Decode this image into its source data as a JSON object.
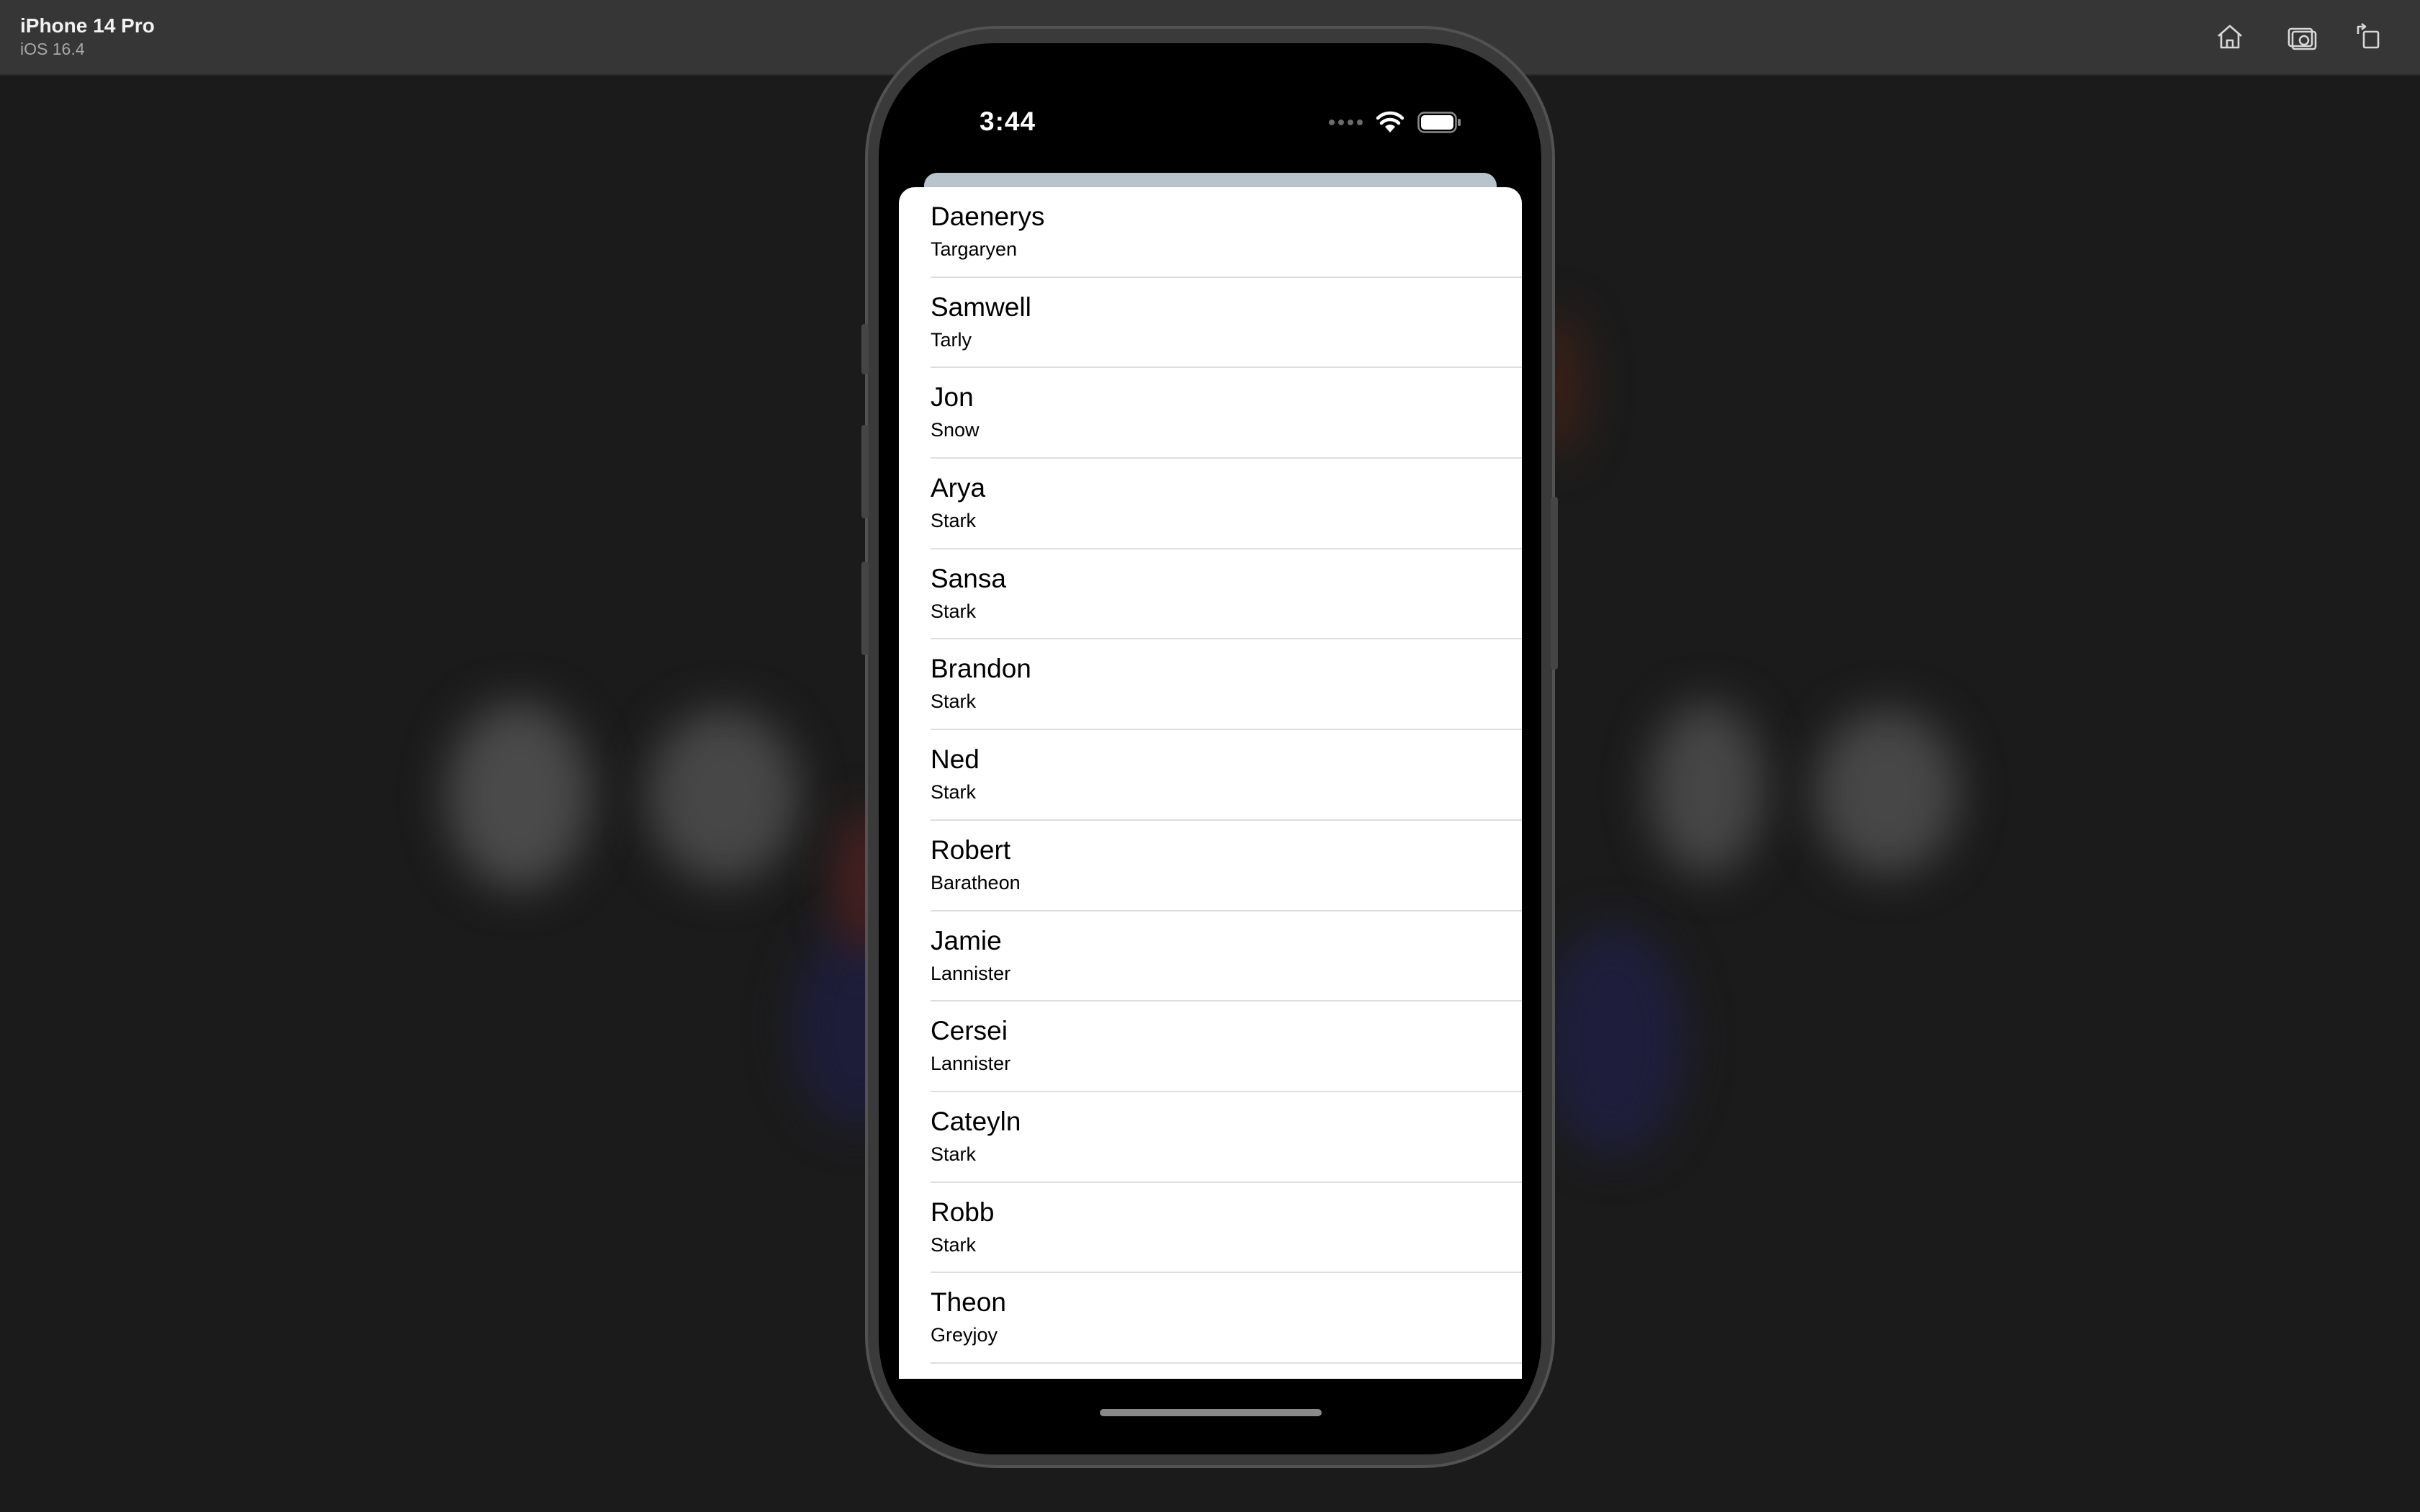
{
  "simulator": {
    "device_name": "iPhone 14 Pro",
    "os_version": "iOS 16.4",
    "buttons": [
      {
        "name": "home",
        "icon": "house-icon"
      },
      {
        "name": "screenshot",
        "icon": "camera-icon"
      },
      {
        "name": "rotate",
        "icon": "rotate-icon"
      }
    ]
  },
  "status_bar": {
    "time": "3:44"
  },
  "list": {
    "items": [
      {
        "first": "Daenerys",
        "last": "Targaryen"
      },
      {
        "first": "Samwell",
        "last": "Tarly"
      },
      {
        "first": "Jon",
        "last": "Snow"
      },
      {
        "first": "Arya",
        "last": "Stark"
      },
      {
        "first": "Sansa",
        "last": "Stark"
      },
      {
        "first": "Brandon",
        "last": "Stark"
      },
      {
        "first": "Ned",
        "last": "Stark"
      },
      {
        "first": "Robert",
        "last": "Baratheon"
      },
      {
        "first": "Jamie",
        "last": "Lannister"
      },
      {
        "first": "Cersei",
        "last": "Lannister"
      },
      {
        "first": "Cateyln",
        "last": "Stark"
      },
      {
        "first": "Robb",
        "last": "Stark"
      },
      {
        "first": "Theon",
        "last": "Greyjoy"
      }
    ]
  }
}
